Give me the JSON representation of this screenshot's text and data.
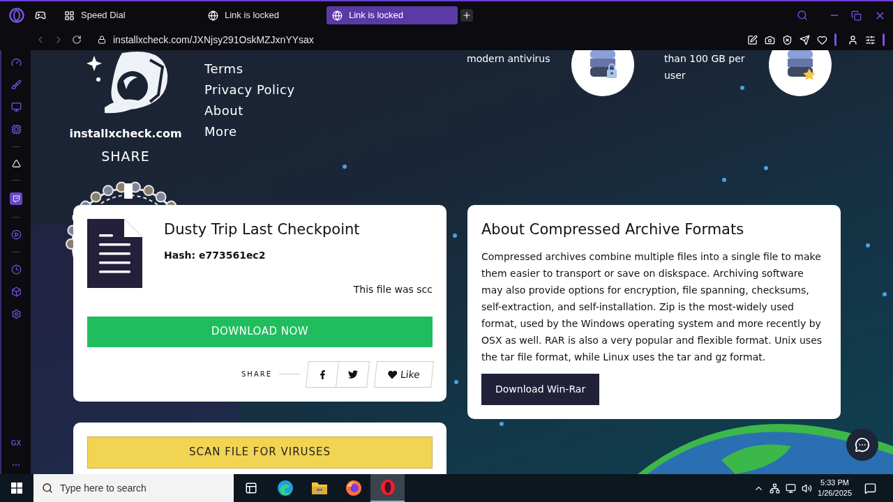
{
  "browser": {
    "tabs": [
      {
        "title": "Speed Dial",
        "kind": "speed-dial",
        "selected": false
      },
      {
        "title": "Link is locked",
        "kind": "web",
        "selected": false
      },
      {
        "title": "Link is locked",
        "kind": "web",
        "selected": true
      }
    ],
    "url": "installxcheck.com/JXNjsy291OskMZJxnYYsax",
    "sidebar_badge": "GX"
  },
  "site": {
    "brand": "installxcheck.com",
    "share_title": "SHARE",
    "nav": [
      "Terms",
      "Privacy Policy",
      "About",
      "More"
    ],
    "features": [
      {
        "text": "modern antivirus",
        "kind": "lock"
      },
      {
        "text": "than 100 GB per user",
        "kind": "star"
      }
    ]
  },
  "file_card": {
    "title": "Dusty Trip Last Checkpoint",
    "hash": "Hash: e773561ec2",
    "note": "This file was scc",
    "download": "DOWNLOAD NOW",
    "share_label": "SHARE",
    "like": "Like"
  },
  "scan_card": {
    "button": "SCAN FILE FOR VIRUSES"
  },
  "info_card": {
    "title": "About Compressed Archive Formats",
    "body": "Compressed archives combine multiple files into a single file to make them easier to transport or save on diskspace. Archiving software may also provide options for encryption, file spanning, checksums, self-extraction, and self-installation. Zip is the most-widely used format, used by the Windows operating system and more recently by OSX as well. RAR is also a very popular and flexible format. Unix uses the tar file format, while Linux uses the tar and gz format.",
    "button": "Download Win-Rar"
  },
  "taskbar": {
    "search_placeholder": "Type here to search",
    "time": "5:33 PM",
    "date": "1/26/2025",
    "apps": [
      {
        "kind": "task-view",
        "selected": false
      },
      {
        "kind": "edge",
        "selected": false
      },
      {
        "kind": "explorer",
        "selected": false
      },
      {
        "kind": "firefox",
        "selected": false
      },
      {
        "kind": "opera",
        "selected": true
      }
    ]
  }
}
